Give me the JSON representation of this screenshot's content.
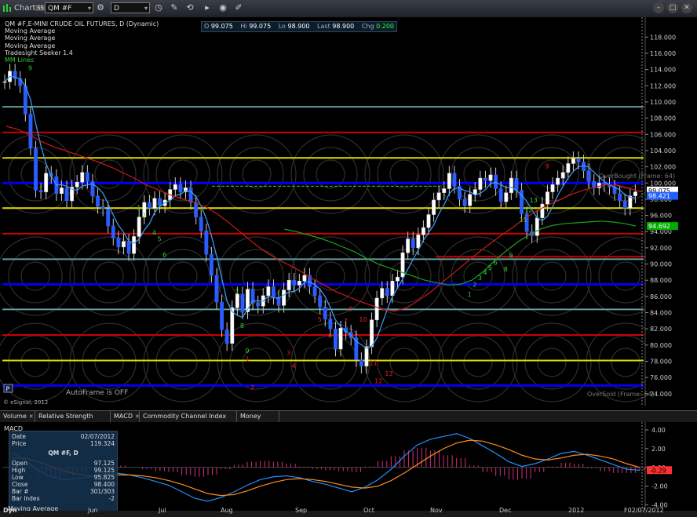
{
  "toolbar": {
    "title": "Chart",
    "badge": "SS",
    "symbol": "QM #F",
    "interval": "D",
    "tools": [
      "draw-line-icon",
      "link-icon",
      "play-icon",
      "target-icon",
      "eraser-icon"
    ]
  },
  "legend": {
    "title": "QM #F,E-MINI CRUDE OIL FUTURES, D (Dynamic)",
    "items": [
      "Moving Average",
      "Moving Average",
      "Moving Average",
      "Tradesight Seeker 1.4",
      "MM Lines"
    ]
  },
  "ohlc": {
    "o_label": "O",
    "o": "99.075",
    "hi_label": "Hi",
    "hi": "99.075",
    "lo_label": "Lo",
    "lo": "98.900",
    "last_label": "Last",
    "last": "98.900",
    "chg_label": "Chg",
    "chg": "0.200"
  },
  "annotations": {
    "autoframe": "AutoFrame is OFF",
    "copyright": "© eSignal, 2012",
    "overbought": "OverBought (Frame: 64)",
    "oversold": "OverSold (Frame: 64)",
    "p_button": "P"
  },
  "price_axis": {
    "labels": [
      "118.000",
      "116.000",
      "114.000",
      "112.000",
      "110.000",
      "108.000",
      "106.000",
      "104.000",
      "102.000",
      "100.000",
      "98.000",
      "96.000",
      "94.000",
      "92.000",
      "90.000",
      "88.000",
      "86.000",
      "84.000",
      "82.000",
      "80.000",
      "78.000",
      "76.000",
      "74.000"
    ],
    "flags": [
      {
        "text": "99.075",
        "color": "#ffffff",
        "fg": "#000000"
      },
      {
        "text": "98.421",
        "color": "#2060ff",
        "fg": "#ffffff"
      },
      {
        "text": "94.692",
        "color": "#00aa00",
        "fg": "#ffffff"
      }
    ]
  },
  "study_tabs": [
    "Volume",
    "Relative Strength Index",
    "MACD",
    "Commodity Channel Index (CCI)",
    "Money Flow"
  ],
  "macd": {
    "label": "MACD",
    "axis": [
      "4.00",
      "2.00",
      "0.00",
      "-2.00",
      "-4.00"
    ],
    "flag": {
      "text": "-0.29",
      "color": "#ff3030"
    }
  },
  "data_window": {
    "date_label": "Date",
    "date": "02/07/2012",
    "price_label": "Price",
    "price": "119.324",
    "symbol": "QM #F, D",
    "open_label": "Open",
    "open": "97.125",
    "high_label": "High",
    "high": "99.125",
    "low_label": "Low",
    "low": "95.825",
    "close_label": "Close",
    "close": "98.400",
    "bar_label": "Bar #",
    "bar": "301/303",
    "index_label": "Bar Index",
    "index": "-2",
    "ma_label": "Moving Average",
    "dyn": "Dyn"
  },
  "x_axis": {
    "labels": [
      "Jun",
      "Jul",
      "Aug",
      "Sep",
      "Oct",
      "Nov",
      "Dec",
      "2012",
      "F02/07/2012"
    ]
  },
  "chart_data": {
    "type": "line",
    "ylim": [
      73.5,
      119
    ],
    "x_categories": [
      "Jun",
      "Jul",
      "Aug",
      "Sep",
      "Oct",
      "Nov",
      "Dec",
      "2012",
      "Feb"
    ],
    "horizontal_levels": [
      {
        "value": 109.4,
        "color": "#5f9ea0"
      },
      {
        "value": 106.25,
        "color": "#cc0000"
      },
      {
        "value": 103.1,
        "color": "#dddd00"
      },
      {
        "value": 100.0,
        "color": "#0000ee"
      },
      {
        "value": 96.9,
        "color": "#dddd00"
      },
      {
        "value": 93.75,
        "color": "#cc0000"
      },
      {
        "value": 90.6,
        "color": "#5f9ea0"
      },
      {
        "value": 87.5,
        "color": "#0000ee"
      },
      {
        "value": 84.4,
        "color": "#5f9ea0"
      },
      {
        "value": 81.25,
        "color": "#cc0000"
      },
      {
        "value": 78.1,
        "color": "#dddd00"
      },
      {
        "value": 75.0,
        "color": "#0000ee"
      }
    ],
    "closes": [
      112.5,
      113.8,
      112.9,
      112.0,
      108.5,
      104.3,
      99.1,
      98.9,
      101.2,
      100.8,
      98.7,
      99.4,
      97.8,
      99.5,
      100.1,
      101.3,
      100.2,
      98.4,
      97.1,
      96.8,
      94.7,
      93.2,
      92.1,
      92.8,
      91.3,
      93.4,
      95.8,
      97.6,
      96.9,
      98.1,
      97.2,
      97.9,
      99.2,
      99.8,
      98.9,
      99.4,
      97.6,
      95.8,
      94.1,
      91.2,
      88.6,
      85.3,
      81.9,
      80.2,
      84.6,
      86.3,
      84.1,
      86.9,
      85.2,
      84.8,
      86.1,
      87.2,
      85.9,
      84.9,
      86.8,
      88.0,
      87.4,
      87.9,
      88.6,
      87.2,
      86.1,
      84.7,
      83.2,
      82.0,
      79.5,
      82.1,
      81.6,
      80.9,
      78.2,
      77.4,
      79.8,
      83.1,
      85.8,
      87.0,
      86.1,
      87.9,
      88.4,
      91.4,
      93.1,
      92.0,
      93.6,
      94.5,
      96.1,
      97.9,
      98.8,
      99.3,
      101.2,
      99.6,
      98.0,
      97.2,
      98.6,
      99.2,
      100.6,
      100.3,
      101.0,
      99.3,
      97.7,
      98.8,
      100.6,
      99.1,
      96.2,
      94.0,
      93.5,
      95.7,
      97.4,
      98.9,
      99.8,
      100.6,
      101.3,
      102.4,
      103.0,
      102.6,
      101.5,
      100.2,
      99.4,
      100.0,
      99.8,
      99.5,
      98.7,
      97.8,
      96.9,
      98.4,
      98.9
    ],
    "ma_red": [
      107,
      106.6,
      105.9,
      105.1,
      104.5,
      104.0,
      103.5,
      103.0,
      102.5,
      101.9,
      101.2,
      100.5,
      99.7,
      99.1,
      98.5,
      98.0,
      97.6,
      97.0,
      96.1,
      95.0,
      93.8,
      92.6,
      91.5,
      90.6,
      89.9,
      89.1,
      88.2,
      87.4,
      86.6,
      86.0,
      85.4,
      84.9,
      84.4,
      84.2,
      84.6,
      85.5,
      86.5,
      87.7,
      88.9,
      90.1,
      91.3,
      92.4,
      93.5,
      94.5,
      95.6,
      96.5,
      97.3,
      97.9,
      98.6,
      99.1,
      99.5,
      99.8,
      99.7,
      99.3,
      98.9
    ],
    "ma_green_start": 0.44,
    "ma_green": [
      94.3,
      94.0,
      93.6,
      93.2,
      92.7,
      92.1,
      91.5,
      90.7,
      90.0,
      89.5,
      89.0,
      88.5,
      88.0,
      87.7,
      87.4,
      87.5,
      88.0,
      89.1,
      90.5,
      91.7,
      92.8,
      93.7,
      94.4,
      94.8,
      95.0,
      95.1,
      95.2,
      95.3,
      95.2,
      95.0,
      94.7
    ],
    "seeker_counts_green": [
      {
        "i": 5,
        "label": "9",
        "value": 113.9
      },
      {
        "i": 26,
        "label": "1",
        "value": 96.7
      },
      {
        "i": 27,
        "label": "2",
        "value": 95.7
      },
      {
        "i": 29,
        "label": "4",
        "value": 93.6
      },
      {
        "i": 30,
        "label": "5",
        "value": 92.8
      },
      {
        "i": 31,
        "label": "6",
        "value": 90.9
      },
      {
        "i": 45,
        "label": "7",
        "value": 86.3
      },
      {
        "i": 46,
        "label": "8",
        "value": 82.1
      },
      {
        "i": 47,
        "label": "9",
        "value": 79.0
      },
      {
        "i": 90,
        "label": "1",
        "value": 86.0
      },
      {
        "i": 91,
        "label": "2",
        "value": 87.2
      },
      {
        "i": 92,
        "label": "3",
        "value": 88.0
      },
      {
        "i": 93,
        "label": "4",
        "value": 88.7
      },
      {
        "i": 94,
        "label": "5",
        "value": 89.3
      },
      {
        "i": 95,
        "label": "6",
        "value": 89.9
      },
      {
        "i": 97,
        "label": "8",
        "value": 89.1
      },
      {
        "i": 98,
        "label": "9",
        "value": 90.8
      },
      {
        "i": 100,
        "label": "11",
        "value": 95.2
      },
      {
        "i": 101,
        "label": "12",
        "value": 96.4
      },
      {
        "i": 102,
        "label": "13",
        "value": 97.6
      }
    ],
    "seeker_counts_red": [
      {
        "i": 47,
        "label": "1",
        "value": 78.0
      },
      {
        "i": 48,
        "label": "2",
        "value": 74.5
      },
      {
        "i": 55,
        "label": "3",
        "value": 78.8
      },
      {
        "i": 56,
        "label": "4",
        "value": 77.2
      },
      {
        "i": 61,
        "label": "5",
        "value": 82.9
      },
      {
        "i": 63,
        "label": "6",
        "value": 80.9
      },
      {
        "i": 66,
        "label": "7",
        "value": 82.7
      },
      {
        "i": 67,
        "label": "8",
        "value": 84.2
      },
      {
        "i": 69,
        "label": "10",
        "value": 82.9
      },
      {
        "i": 71,
        "label": "11",
        "value": 77.5
      },
      {
        "i": 72,
        "label": "12",
        "value": 75.3
      },
      {
        "i": 74,
        "label": "13",
        "value": 76.2
      },
      {
        "i": 105,
        "label": "9",
        "value": 101.8
      }
    ],
    "macd_range": [
      -4.2,
      4.5
    ],
    "macd_line": [
      1.6,
      0.8,
      -0.3,
      -1.0,
      -1.3,
      -1.2,
      -1.0,
      -0.7,
      -0.6,
      -0.8,
      -1.1,
      -1.5,
      -1.9,
      -2.6,
      -3.3,
      -3.6,
      -3.2,
      -2.6,
      -1.9,
      -1.3,
      -1.0,
      -0.9,
      -1.1,
      -1.5,
      -1.8,
      -2.2,
      -2.6,
      -2.1,
      -1.3,
      -0.2,
      1.2,
      2.4,
      3.0,
      3.3,
      3.6,
      3.1,
      2.3,
      1.5,
      0.6,
      0.1,
      0.4,
      0.9,
      1.5,
      1.7,
      1.3,
      0.8,
      0.3,
      -0.2,
      -0.3
    ],
    "macd_signal": [
      1.0,
      1.0,
      0.6,
      0.1,
      -0.4,
      -0.7,
      -0.9,
      -0.9,
      -0.8,
      -0.8,
      -0.9,
      -1.1,
      -1.4,
      -1.8,
      -2.3,
      -2.8,
      -3.0,
      -2.9,
      -2.5,
      -2.0,
      -1.6,
      -1.3,
      -1.2,
      -1.3,
      -1.5,
      -1.8,
      -2.1,
      -2.2,
      -2.0,
      -1.4,
      -0.6,
      0.3,
      1.2,
      2.0,
      2.6,
      2.9,
      2.8,
      2.4,
      1.9,
      1.3,
      0.9,
      0.8,
      1.0,
      1.3,
      1.4,
      1.2,
      0.9,
      0.4,
      0.0
    ],
    "macd_hist_sample": [
      0.6,
      -0.2,
      -0.9,
      -1.1,
      -0.9,
      -0.5,
      -0.1,
      0.2,
      0.2,
      0.0,
      -0.2,
      -0.4,
      -0.5,
      -0.8,
      -1.0,
      -0.8,
      -0.2,
      0.3,
      0.6,
      0.7,
      0.6,
      0.4,
      0.1,
      -0.2,
      -0.3,
      -0.4,
      -0.5,
      0.1,
      0.7,
      1.2,
      1.8,
      2.1,
      1.8,
      1.3,
      1.0,
      0.2,
      -0.5,
      -0.9,
      -1.3,
      -1.2,
      -0.5,
      0.1,
      0.5,
      0.4,
      -0.1,
      -0.4,
      -0.6,
      -0.6,
      -0.3
    ]
  }
}
